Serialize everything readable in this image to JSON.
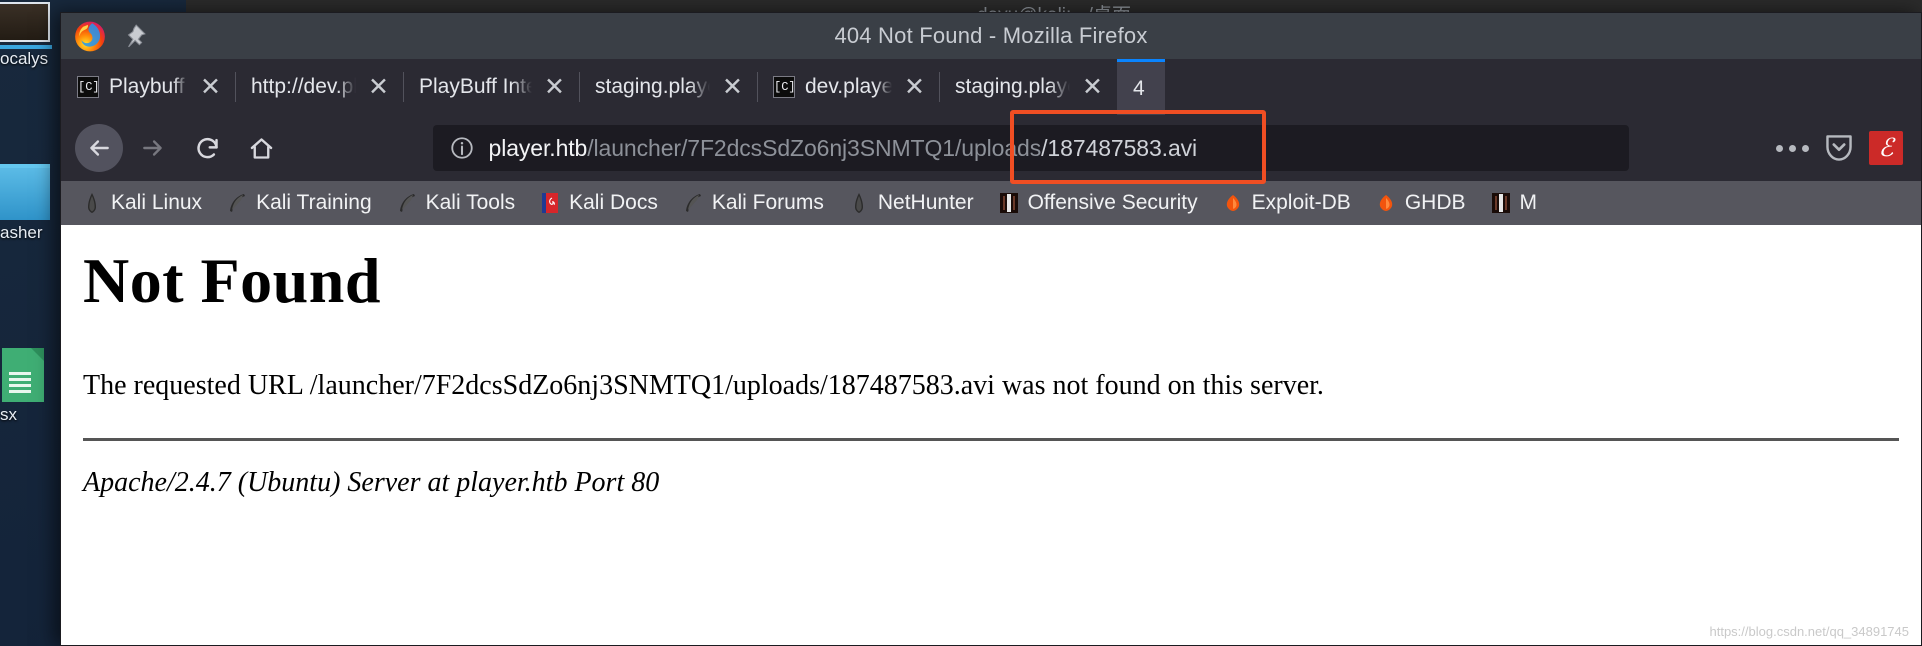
{
  "desktop": {
    "icons": [
      {
        "label": "ocalys",
        "kind": "photo"
      },
      {
        "label": "asher",
        "kind": "blue"
      },
      {
        "label": "sx",
        "kind": "green"
      }
    ]
  },
  "terminal": {
    "title": "davu@kali: ~/桌面",
    "lines": [
      "]",
      "]",
      "]",
      "]",
      "]"
    ]
  },
  "window": {
    "title": "404 Not Found - Mozilla Firefox",
    "logo_icon": "firefox-logo",
    "pin_icon": "pin-icon"
  },
  "tabs": [
    {
      "label": "Playbuff - Dev P",
      "favicon": "[C]",
      "has_favicon": true,
      "close": "✕",
      "active": false,
      "width_class": "tab-w1"
    },
    {
      "label": "http://dev.player.h",
      "favicon": "",
      "has_favicon": false,
      "close": "✕",
      "active": false,
      "width_class": "tab-w2"
    },
    {
      "label": "PlayBuff Internal C",
      "favicon": "",
      "has_favicon": false,
      "close": "✕",
      "active": false,
      "width_class": "tab-w3"
    },
    {
      "label": "staging.player.htb",
      "favicon": "",
      "has_favicon": false,
      "close": "✕",
      "active": false,
      "width_class": "tab-w4"
    },
    {
      "label": "dev.player.htbA",
      "favicon": "[C]",
      "has_favicon": true,
      "close": "✕",
      "active": false,
      "width_class": "tab-w5"
    },
    {
      "label": "staging.player.htb",
      "favicon": "",
      "has_favicon": false,
      "close": "✕",
      "active": false,
      "width_class": "tab-w6"
    },
    {
      "label": "4",
      "favicon": "",
      "has_favicon": false,
      "close": "",
      "active": true,
      "width_class": "tab-w7"
    }
  ],
  "toolbar": {
    "back_icon": "back-arrow-icon",
    "forward_icon": "forward-arrow-icon",
    "reload_icon": "reload-icon",
    "home_icon": "home-icon",
    "menu_icon": "more-options-icon",
    "pocket_icon": "pocket-icon",
    "flash_badge": "ℰ"
  },
  "urlbar": {
    "info_icon": "page-info-icon",
    "host": "player.htb",
    "path_before": "/launcher/7F2dcsSdZo6nj3SNMTQ1/uploads",
    "path_highlight": "/187487583.avi",
    "full_url": "player.htb/launcher/7F2dcsSdZo6nj3SNMTQ1/uploads/187487583.avi",
    "highlight_color": "#f04e23"
  },
  "bookmarks": [
    {
      "label": "Kali Linux",
      "icon": "kali-dragon-icon"
    },
    {
      "label": "Kali Training",
      "icon": "kali-feather-icon"
    },
    {
      "label": "Kali Tools",
      "icon": "kali-feather-icon"
    },
    {
      "label": "Kali Docs",
      "icon": "kali-docs-book-icon"
    },
    {
      "label": "Kali Forums",
      "icon": "kali-feather-icon"
    },
    {
      "label": "NetHunter",
      "icon": "kali-dragon-icon"
    },
    {
      "label": "Offensive Security",
      "icon": "offsec-icon"
    },
    {
      "label": "Exploit-DB",
      "icon": "exploit-db-icon"
    },
    {
      "label": "GHDB",
      "icon": "exploit-db-icon"
    },
    {
      "label": "M",
      "icon": "offsec-icon"
    }
  ],
  "content": {
    "heading": "Not Found",
    "paragraph": "The requested URL /launcher/7F2dcsSdZo6nj3SNMTQ1/uploads/187487583.avi was not found on this server.",
    "server_signature": "Apache/2.4.7 (Ubuntu) Server at player.htb Port 80",
    "watermark": "https://blog.csdn.net/qq_34891745"
  }
}
